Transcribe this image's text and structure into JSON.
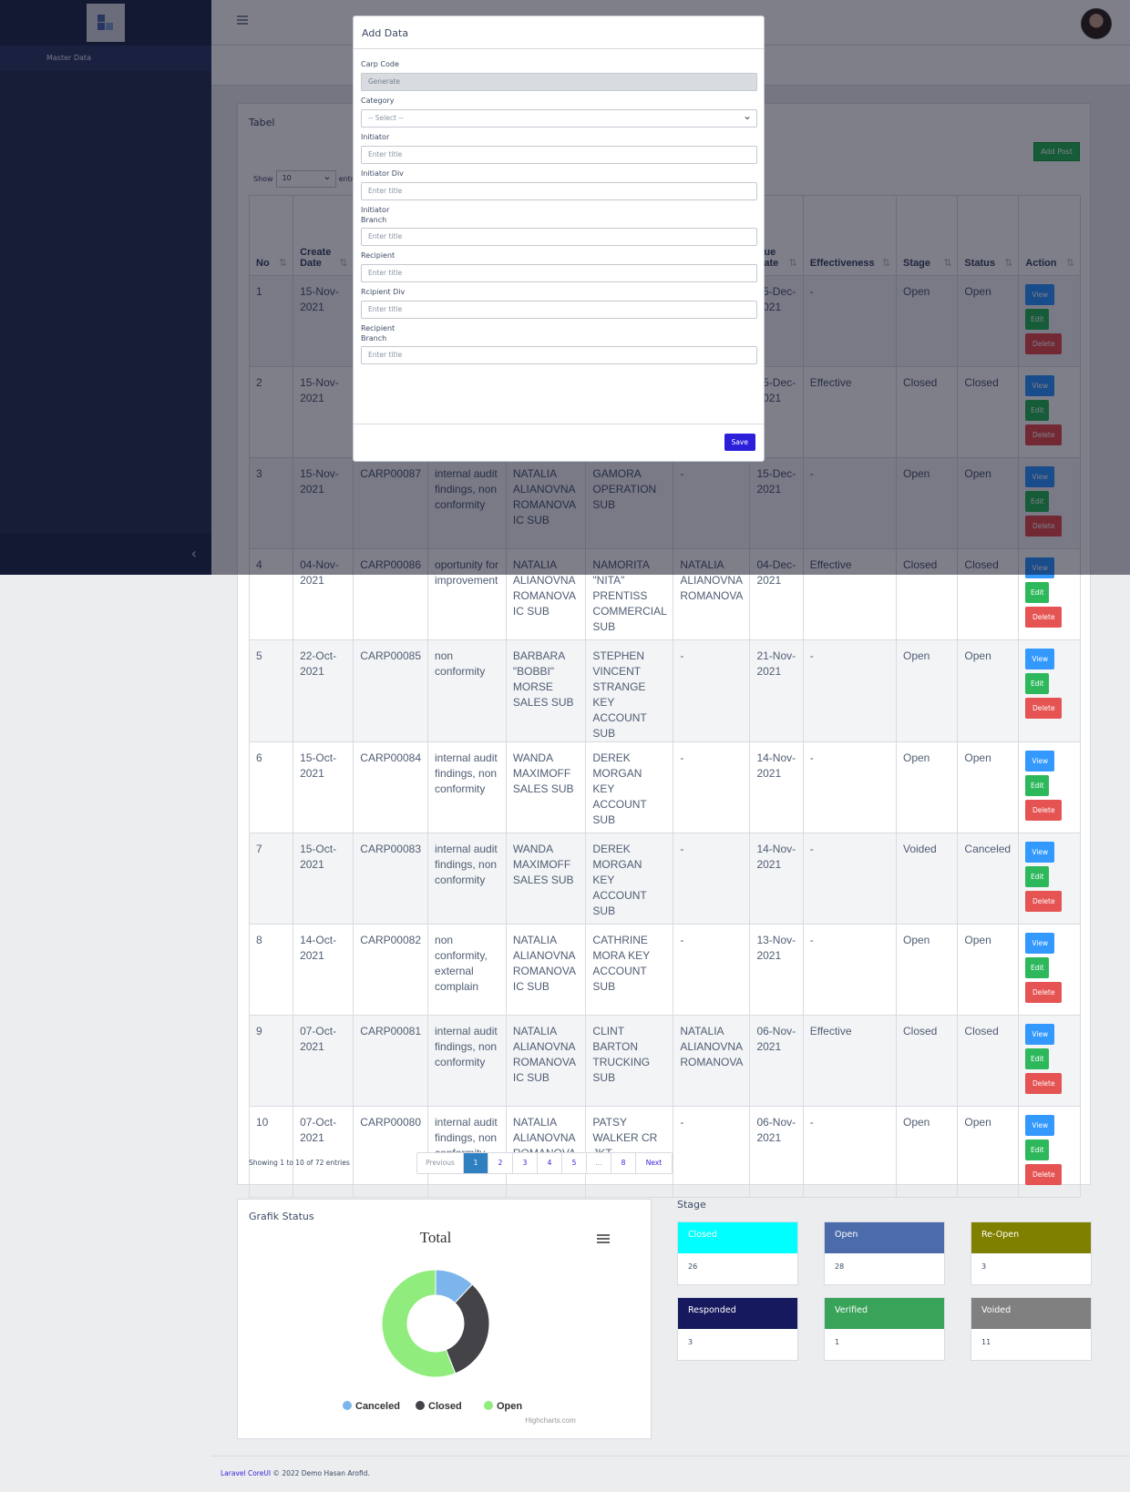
{
  "sidebar": {
    "nav_items": [
      "Master Data"
    ]
  },
  "table_card": {
    "title": "Tabel",
    "add_button": "Add Post",
    "show_label": "Show",
    "show_value": "10",
    "entries_label": "entries",
    "columns": [
      "No",
      "Create Date",
      "",
      "",
      "",
      "",
      "",
      "Due Date",
      "Effectiveness",
      "Stage",
      "Status",
      "Action"
    ],
    "rows": [
      {
        "no": "1",
        "date": "15-Nov-2021",
        "code": "",
        "category": "",
        "initiator": "",
        "recipient": "",
        "verifier": "",
        "due": "15-Dec-2021",
        "effectiveness": "-",
        "stage": "Open",
        "status": "Open"
      },
      {
        "no": "2",
        "date": "15-Nov-2021",
        "code": "",
        "category": "",
        "initiator": "",
        "recipient": "",
        "verifier": "",
        "due": "15-Dec-2021",
        "effectiveness": "Effective",
        "stage": "Closed",
        "status": "Closed"
      },
      {
        "no": "3",
        "date": "15-Nov-2021",
        "code": "CARP00087",
        "category": "internal audit findings, non conformity",
        "initiator": "NATALIA ALIANOVNA ROMANOVA IC SUB",
        "recipient": "GAMORA OPERATION SUB",
        "verifier": "-",
        "due": "15-Dec-2021",
        "effectiveness": "-",
        "stage": "Open",
        "status": "Open"
      },
      {
        "no": "4",
        "date": "04-Nov-2021",
        "code": "CARP00086",
        "category": "oportunity for improvement",
        "initiator": "NATALIA ALIANOVNA ROMANOVA IC SUB",
        "recipient": "NAMORITA \"NITA\" PRENTISS COMMERCIAL SUB",
        "verifier": "NATALIA ALIANOVNA ROMANOVA",
        "due": "04-Dec-2021",
        "effectiveness": "Effective",
        "stage": "Closed",
        "status": "Closed"
      },
      {
        "no": "5",
        "date": "22-Oct-2021",
        "code": "CARP00085",
        "category": "non conformity",
        "initiator": "BARBARA \"BOBBI\" MORSE SALES SUB",
        "recipient": "STEPHEN VINCENT STRANGE KEY ACCOUNT SUB",
        "verifier": "-",
        "due": "21-Nov-2021",
        "effectiveness": "-",
        "stage": "Open",
        "status": "Open"
      },
      {
        "no": "6",
        "date": "15-Oct-2021",
        "code": "CARP00084",
        "category": "internal audit findings, non conformity",
        "initiator": "WANDA MAXIMOFF SALES SUB",
        "recipient": "DEREK MORGAN KEY ACCOUNT SUB",
        "verifier": "-",
        "due": "14-Nov-2021",
        "effectiveness": "-",
        "stage": "Open",
        "status": "Open"
      },
      {
        "no": "7",
        "date": "15-Oct-2021",
        "code": "CARP00083",
        "category": "internal audit findings, non conformity",
        "initiator": "WANDA MAXIMOFF SALES SUB",
        "recipient": "DEREK MORGAN KEY ACCOUNT SUB",
        "verifier": "-",
        "due": "14-Nov-2021",
        "effectiveness": "-",
        "stage": "Voided",
        "status": "Canceled"
      },
      {
        "no": "8",
        "date": "14-Oct-2021",
        "code": "CARP00082",
        "category": "non conformity, external complain",
        "initiator": "NATALIA ALIANOVNA ROMANOVA IC SUB",
        "recipient": "CATHRINE MORA KEY ACCOUNT SUB",
        "verifier": "-",
        "due": "13-Nov-2021",
        "effectiveness": "-",
        "stage": "Open",
        "status": "Open"
      },
      {
        "no": "9",
        "date": "07-Oct-2021",
        "code": "CARP00081",
        "category": "internal audit findings, non conformity",
        "initiator": "NATALIA ALIANOVNA ROMANOVA IC SUB",
        "recipient": "CLINT BARTON TRUCKING SUB",
        "verifier": "NATALIA ALIANOVNA ROMANOVA",
        "due": "06-Nov-2021",
        "effectiveness": "Effective",
        "stage": "Closed",
        "status": "Closed"
      },
      {
        "no": "10",
        "date": "07-Oct-2021",
        "code": "CARP00080",
        "category": "internal audit findings, non conformity",
        "initiator": "NATALIA ALIANOVNA ROMANOVA IC SUB",
        "recipient": "PATSY WALKER CR JKT",
        "verifier": "-",
        "due": "06-Nov-2021",
        "effectiveness": "-",
        "stage": "Open",
        "status": "Open"
      }
    ],
    "actions": {
      "view": "View",
      "edit": "Edit",
      "delete": "Delete"
    },
    "info": "Showing 1 to 10 of 72 entries",
    "pagination": [
      "Previous",
      "1",
      "2",
      "3",
      "4",
      "5",
      "...",
      "8",
      "Next"
    ]
  },
  "chart_card": {
    "title": "Grafik Status",
    "credit": "Highcharts.com",
    "menu_icon": "hamburger-menu-icon"
  },
  "chart_data": {
    "type": "pie",
    "title": "Total",
    "donut": true,
    "series": [
      {
        "name": "Canceled",
        "value": 12,
        "color": "#7cb5ec"
      },
      {
        "name": "Closed",
        "value": 32,
        "color": "#434348"
      },
      {
        "name": "Open",
        "value": 56,
        "color": "#90ed7d"
      }
    ],
    "legend": "bottom"
  },
  "stage": {
    "title": "Stage",
    "cards": [
      {
        "label": "Closed",
        "value": "26",
        "color": "#00ffff"
      },
      {
        "label": "Open",
        "value": "28",
        "color": "#4b6baa"
      },
      {
        "label": "Re-Open",
        "value": "3",
        "color": "#808000"
      },
      {
        "label": "Responded",
        "value": "3",
        "color": "#16195e"
      },
      {
        "label": "Verified",
        "value": "1",
        "color": "#3aa35a"
      },
      {
        "label": "Voided",
        "value": "11",
        "color": "#808080"
      }
    ]
  },
  "footer": {
    "link": "Laravel CoreUI",
    "text": " © 2022 Demo Hasan Arofid."
  },
  "modal": {
    "title": "Add Data",
    "fields": [
      {
        "label": "Carp Code",
        "value": "Generate",
        "kind": "readonly"
      },
      {
        "label": "Category",
        "value": "-- Select --",
        "kind": "select"
      },
      {
        "label": "Initiator",
        "placeholder": "Enter title",
        "kind": "text"
      },
      {
        "label": "Initiator Div",
        "placeholder": "Enter title",
        "kind": "text"
      },
      {
        "label": "Initiator Branch",
        "placeholder": "Enter title",
        "kind": "text"
      },
      {
        "label": "Recipient",
        "placeholder": "Enter title",
        "kind": "text"
      },
      {
        "label": "Rcipient Div",
        "placeholder": "Enter title",
        "kind": "text"
      },
      {
        "label": "Recipient Branch",
        "placeholder": "Enter title",
        "kind": "text"
      }
    ],
    "save_label": "Save"
  }
}
